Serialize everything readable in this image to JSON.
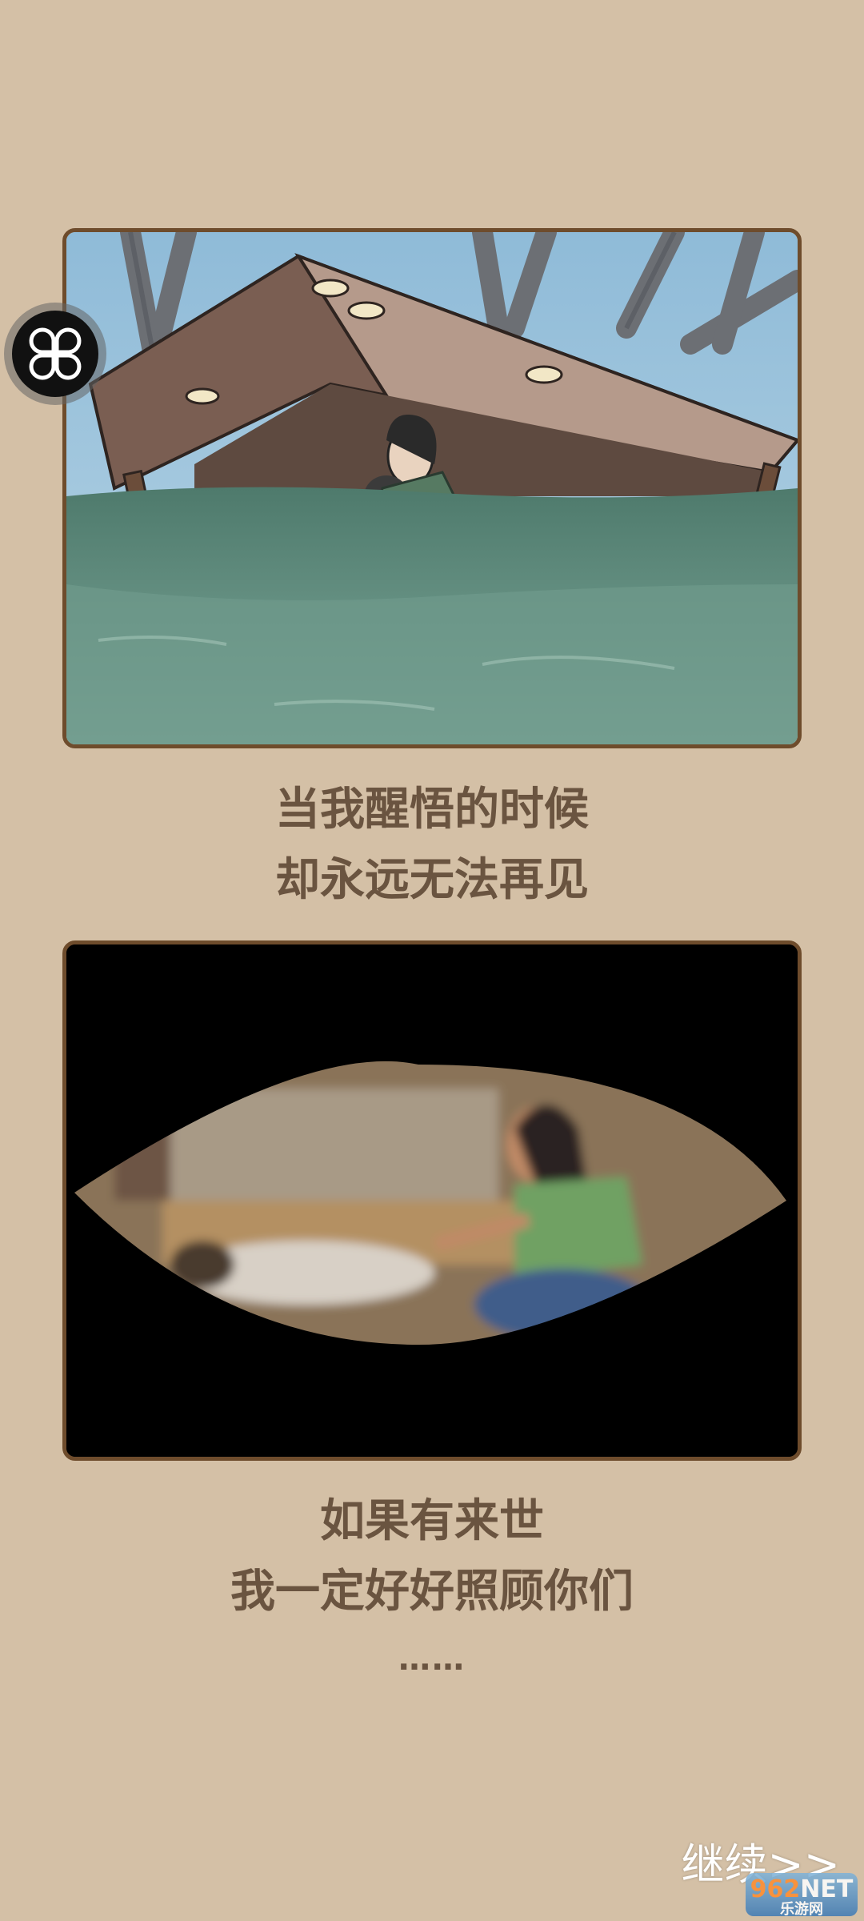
{
  "captions": {
    "first": [
      "当我醒悟的时候",
      "却永远无法再见"
    ],
    "second": [
      "如果有来世",
      "我一定好好照顾你们"
    ],
    "ellipsis": "……"
  },
  "buttons": {
    "continue_label": "继续>>",
    "float_icon": "clover-menu-icon"
  },
  "watermark": {
    "brand_number": "962",
    "brand_suffix": "NET",
    "brand_sub": "乐游网"
  },
  "colors": {
    "background": "#d4c0a6",
    "panel_border": "#6e4c2c",
    "caption_text": "#6a5440"
  }
}
